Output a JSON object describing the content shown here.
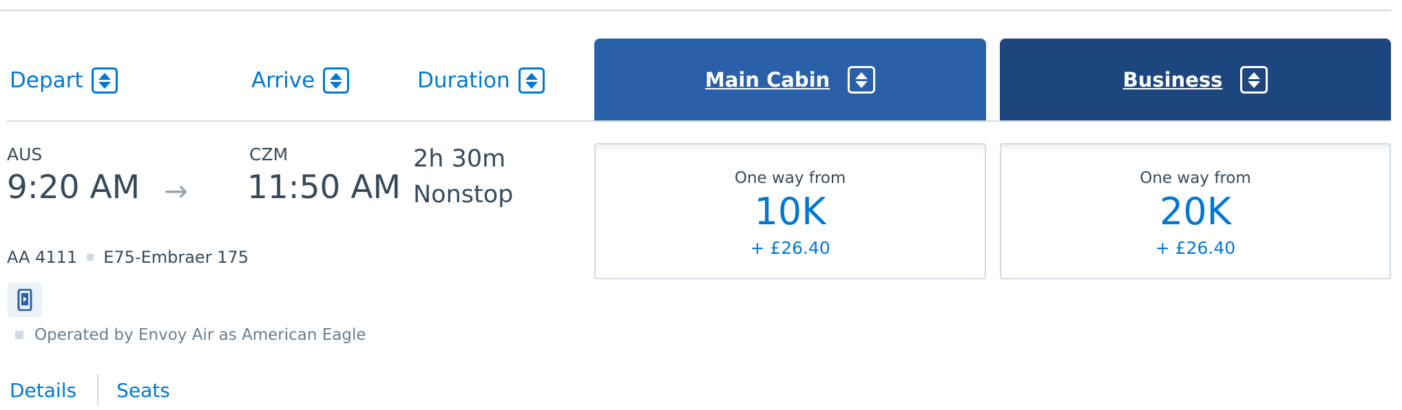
{
  "sort_headers": {
    "depart": "Depart",
    "arrive": "Arrive",
    "duration": "Duration"
  },
  "cabins": [
    {
      "label": "Main Cabin",
      "color": "#2960a8"
    },
    {
      "label": "Business",
      "color": "#1e467e"
    }
  ],
  "flight": {
    "origin": "AUS",
    "depart_time": "9:20 AM",
    "destination": "CZM",
    "arrive_time": "11:50 AM",
    "duration": "2h 30m",
    "stops": "Nonstop",
    "number": "AA 4111",
    "aircraft": "E75-Embraer 175",
    "operated_by": "Operated by Envoy Air as American Eagle"
  },
  "links": {
    "details": "Details",
    "seats": "Seats"
  },
  "fares": [
    {
      "from_label": "One way from",
      "price": "10K",
      "tax": "+ £26.40"
    },
    {
      "from_label": "One way from",
      "price": "20K",
      "tax": "+ £26.40"
    }
  ],
  "icons": {
    "sort": "sort-icon",
    "arrow": "arrow-right-icon",
    "device": "mobile-entertainment-icon"
  },
  "colors": {
    "link": "#0078d2",
    "main_cabin": "#2960a8",
    "business": "#1e467e",
    "text": "#36495a"
  }
}
